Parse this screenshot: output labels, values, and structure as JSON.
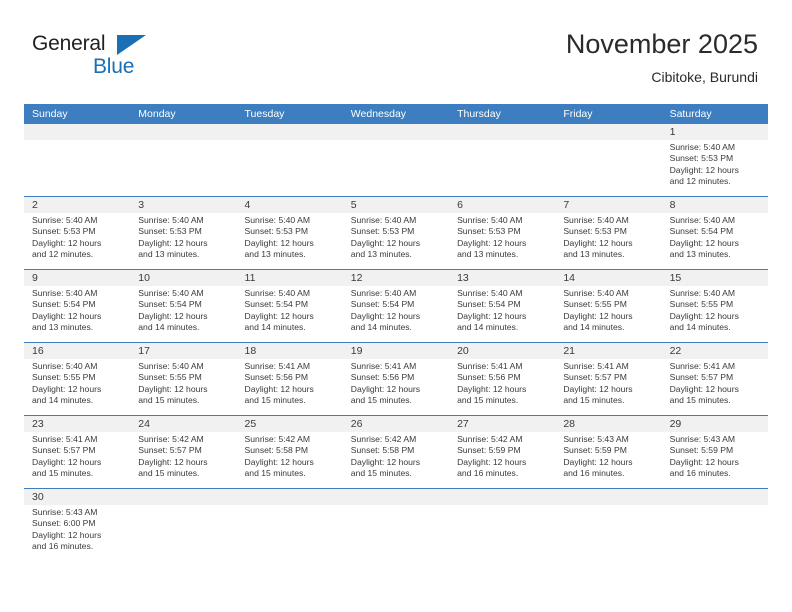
{
  "brand": {
    "name_top": "General",
    "name_bottom": "Blue",
    "triangle_color": "#1b6fb5",
    "accent_color": "#3c7ebf"
  },
  "header": {
    "title": "November 2025",
    "subtitle": "Cibitoke, Burundi"
  },
  "calendar": {
    "weekday_headers": [
      "Sunday",
      "Monday",
      "Tuesday",
      "Wednesday",
      "Thursday",
      "Friday",
      "Saturday"
    ],
    "header_bg": "#3c7ebf",
    "daynum_bg": "#f1f1f1",
    "weeks": [
      [
        {
          "day": "",
          "sunrise": "",
          "sunset": "",
          "daylight_line1": "",
          "daylight_line2": ""
        },
        {
          "day": "",
          "sunrise": "",
          "sunset": "",
          "daylight_line1": "",
          "daylight_line2": ""
        },
        {
          "day": "",
          "sunrise": "",
          "sunset": "",
          "daylight_line1": "",
          "daylight_line2": ""
        },
        {
          "day": "",
          "sunrise": "",
          "sunset": "",
          "daylight_line1": "",
          "daylight_line2": ""
        },
        {
          "day": "",
          "sunrise": "",
          "sunset": "",
          "daylight_line1": "",
          "daylight_line2": ""
        },
        {
          "day": "",
          "sunrise": "",
          "sunset": "",
          "daylight_line1": "",
          "daylight_line2": ""
        },
        {
          "day": "1",
          "sunrise": "Sunrise: 5:40 AM",
          "sunset": "Sunset: 5:53 PM",
          "daylight_line1": "Daylight: 12 hours",
          "daylight_line2": "and 12 minutes."
        }
      ],
      [
        {
          "day": "2",
          "sunrise": "Sunrise: 5:40 AM",
          "sunset": "Sunset: 5:53 PM",
          "daylight_line1": "Daylight: 12 hours",
          "daylight_line2": "and 12 minutes."
        },
        {
          "day": "3",
          "sunrise": "Sunrise: 5:40 AM",
          "sunset": "Sunset: 5:53 PM",
          "daylight_line1": "Daylight: 12 hours",
          "daylight_line2": "and 13 minutes."
        },
        {
          "day": "4",
          "sunrise": "Sunrise: 5:40 AM",
          "sunset": "Sunset: 5:53 PM",
          "daylight_line1": "Daylight: 12 hours",
          "daylight_line2": "and 13 minutes."
        },
        {
          "day": "5",
          "sunrise": "Sunrise: 5:40 AM",
          "sunset": "Sunset: 5:53 PM",
          "daylight_line1": "Daylight: 12 hours",
          "daylight_line2": "and 13 minutes."
        },
        {
          "day": "6",
          "sunrise": "Sunrise: 5:40 AM",
          "sunset": "Sunset: 5:53 PM",
          "daylight_line1": "Daylight: 12 hours",
          "daylight_line2": "and 13 minutes."
        },
        {
          "day": "7",
          "sunrise": "Sunrise: 5:40 AM",
          "sunset": "Sunset: 5:53 PM",
          "daylight_line1": "Daylight: 12 hours",
          "daylight_line2": "and 13 minutes."
        },
        {
          "day": "8",
          "sunrise": "Sunrise: 5:40 AM",
          "sunset": "Sunset: 5:54 PM",
          "daylight_line1": "Daylight: 12 hours",
          "daylight_line2": "and 13 minutes."
        }
      ],
      [
        {
          "day": "9",
          "sunrise": "Sunrise: 5:40 AM",
          "sunset": "Sunset: 5:54 PM",
          "daylight_line1": "Daylight: 12 hours",
          "daylight_line2": "and 13 minutes."
        },
        {
          "day": "10",
          "sunrise": "Sunrise: 5:40 AM",
          "sunset": "Sunset: 5:54 PM",
          "daylight_line1": "Daylight: 12 hours",
          "daylight_line2": "and 14 minutes."
        },
        {
          "day": "11",
          "sunrise": "Sunrise: 5:40 AM",
          "sunset": "Sunset: 5:54 PM",
          "daylight_line1": "Daylight: 12 hours",
          "daylight_line2": "and 14 minutes."
        },
        {
          "day": "12",
          "sunrise": "Sunrise: 5:40 AM",
          "sunset": "Sunset: 5:54 PM",
          "daylight_line1": "Daylight: 12 hours",
          "daylight_line2": "and 14 minutes."
        },
        {
          "day": "13",
          "sunrise": "Sunrise: 5:40 AM",
          "sunset": "Sunset: 5:54 PM",
          "daylight_line1": "Daylight: 12 hours",
          "daylight_line2": "and 14 minutes."
        },
        {
          "day": "14",
          "sunrise": "Sunrise: 5:40 AM",
          "sunset": "Sunset: 5:55 PM",
          "daylight_line1": "Daylight: 12 hours",
          "daylight_line2": "and 14 minutes."
        },
        {
          "day": "15",
          "sunrise": "Sunrise: 5:40 AM",
          "sunset": "Sunset: 5:55 PM",
          "daylight_line1": "Daylight: 12 hours",
          "daylight_line2": "and 14 minutes."
        }
      ],
      [
        {
          "day": "16",
          "sunrise": "Sunrise: 5:40 AM",
          "sunset": "Sunset: 5:55 PM",
          "daylight_line1": "Daylight: 12 hours",
          "daylight_line2": "and 14 minutes."
        },
        {
          "day": "17",
          "sunrise": "Sunrise: 5:40 AM",
          "sunset": "Sunset: 5:55 PM",
          "daylight_line1": "Daylight: 12 hours",
          "daylight_line2": "and 15 minutes."
        },
        {
          "day": "18",
          "sunrise": "Sunrise: 5:41 AM",
          "sunset": "Sunset: 5:56 PM",
          "daylight_line1": "Daylight: 12 hours",
          "daylight_line2": "and 15 minutes."
        },
        {
          "day": "19",
          "sunrise": "Sunrise: 5:41 AM",
          "sunset": "Sunset: 5:56 PM",
          "daylight_line1": "Daylight: 12 hours",
          "daylight_line2": "and 15 minutes."
        },
        {
          "day": "20",
          "sunrise": "Sunrise: 5:41 AM",
          "sunset": "Sunset: 5:56 PM",
          "daylight_line1": "Daylight: 12 hours",
          "daylight_line2": "and 15 minutes."
        },
        {
          "day": "21",
          "sunrise": "Sunrise: 5:41 AM",
          "sunset": "Sunset: 5:57 PM",
          "daylight_line1": "Daylight: 12 hours",
          "daylight_line2": "and 15 minutes."
        },
        {
          "day": "22",
          "sunrise": "Sunrise: 5:41 AM",
          "sunset": "Sunset: 5:57 PM",
          "daylight_line1": "Daylight: 12 hours",
          "daylight_line2": "and 15 minutes."
        }
      ],
      [
        {
          "day": "23",
          "sunrise": "Sunrise: 5:41 AM",
          "sunset": "Sunset: 5:57 PM",
          "daylight_line1": "Daylight: 12 hours",
          "daylight_line2": "and 15 minutes."
        },
        {
          "day": "24",
          "sunrise": "Sunrise: 5:42 AM",
          "sunset": "Sunset: 5:57 PM",
          "daylight_line1": "Daylight: 12 hours",
          "daylight_line2": "and 15 minutes."
        },
        {
          "day": "25",
          "sunrise": "Sunrise: 5:42 AM",
          "sunset": "Sunset: 5:58 PM",
          "daylight_line1": "Daylight: 12 hours",
          "daylight_line2": "and 15 minutes."
        },
        {
          "day": "26",
          "sunrise": "Sunrise: 5:42 AM",
          "sunset": "Sunset: 5:58 PM",
          "daylight_line1": "Daylight: 12 hours",
          "daylight_line2": "and 15 minutes."
        },
        {
          "day": "27",
          "sunrise": "Sunrise: 5:42 AM",
          "sunset": "Sunset: 5:59 PM",
          "daylight_line1": "Daylight: 12 hours",
          "daylight_line2": "and 16 minutes."
        },
        {
          "day": "28",
          "sunrise": "Sunrise: 5:43 AM",
          "sunset": "Sunset: 5:59 PM",
          "daylight_line1": "Daylight: 12 hours",
          "daylight_line2": "and 16 minutes."
        },
        {
          "day": "29",
          "sunrise": "Sunrise: 5:43 AM",
          "sunset": "Sunset: 5:59 PM",
          "daylight_line1": "Daylight: 12 hours",
          "daylight_line2": "and 16 minutes."
        }
      ],
      [
        {
          "day": "30",
          "sunrise": "Sunrise: 5:43 AM",
          "sunset": "Sunset: 6:00 PM",
          "daylight_line1": "Daylight: 12 hours",
          "daylight_line2": "and 16 minutes."
        },
        {
          "day": "",
          "sunrise": "",
          "sunset": "",
          "daylight_line1": "",
          "daylight_line2": ""
        },
        {
          "day": "",
          "sunrise": "",
          "sunset": "",
          "daylight_line1": "",
          "daylight_line2": ""
        },
        {
          "day": "",
          "sunrise": "",
          "sunset": "",
          "daylight_line1": "",
          "daylight_line2": ""
        },
        {
          "day": "",
          "sunrise": "",
          "sunset": "",
          "daylight_line1": "",
          "daylight_line2": ""
        },
        {
          "day": "",
          "sunrise": "",
          "sunset": "",
          "daylight_line1": "",
          "daylight_line2": ""
        },
        {
          "day": "",
          "sunrise": "",
          "sunset": "",
          "daylight_line1": "",
          "daylight_line2": ""
        }
      ]
    ]
  }
}
